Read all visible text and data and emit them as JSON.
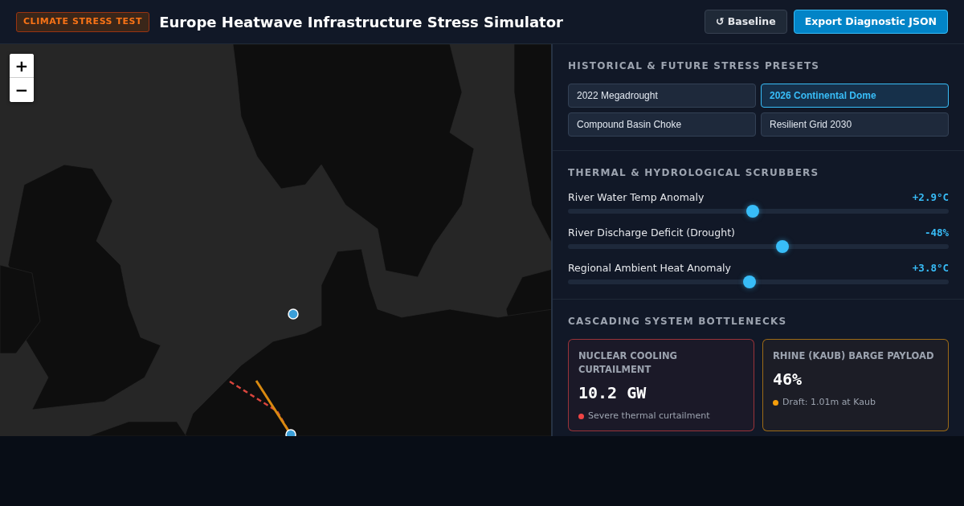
{
  "header": {
    "badge": "CLIMATE STRESS TEST",
    "title": "Europe Heatwave Infrastructure Stress Simulator",
    "buttons": [
      {
        "label": "↺ Baseline",
        "kind": "secondary"
      },
      {
        "label": "Export Diagnostic JSON",
        "kind": "primary"
      }
    ]
  },
  "map": {
    "zoom_controls": [
      {
        "label": "+",
        "kind": "zoom_in"
      },
      {
        "label": "−",
        "kind": "zoom_out"
      }
    ]
  },
  "presets": {
    "heading": "HISTORICAL & FUTURE STRESS PRESETS",
    "items": [
      {
        "label": "2022 Megadrought",
        "selected": false
      },
      {
        "label": "2026 Continental Dome",
        "selected": true
      },
      {
        "label": "Compound Basin Choke",
        "selected": false
      },
      {
        "label": "Resilient Grid 2030",
        "selected": false
      }
    ]
  },
  "scrubbers": {
    "heading": "THERMAL & HYDROLOGICAL SCRUBBERS",
    "sliders": [
      {
        "label": "River Water Temp Anomaly",
        "reading": "+2.9°C",
        "level": 0.485
      },
      {
        "label": "River Discharge Deficit (Drought)",
        "reading": "-48%",
        "level": 0.565
      },
      {
        "label": "Regional Ambient Heat Anomaly",
        "reading": "+3.8°C",
        "level": 0.476
      }
    ]
  },
  "bottlenecks": {
    "heading": "CASCADING SYSTEM BOTTLENECKS",
    "cards": [
      {
        "title": "NUCLEAR COOLING CURTAILMENT",
        "value": "10.2 GW",
        "status": "Severe thermal curtailment",
        "color": "#ef4444"
      },
      {
        "title": "RHINE (KAUB) BARGE PAYLOAD",
        "value": "46%",
        "status": "Draft: 1.01m at Kaub",
        "color": "#f59e0b"
      }
    ]
  }
}
